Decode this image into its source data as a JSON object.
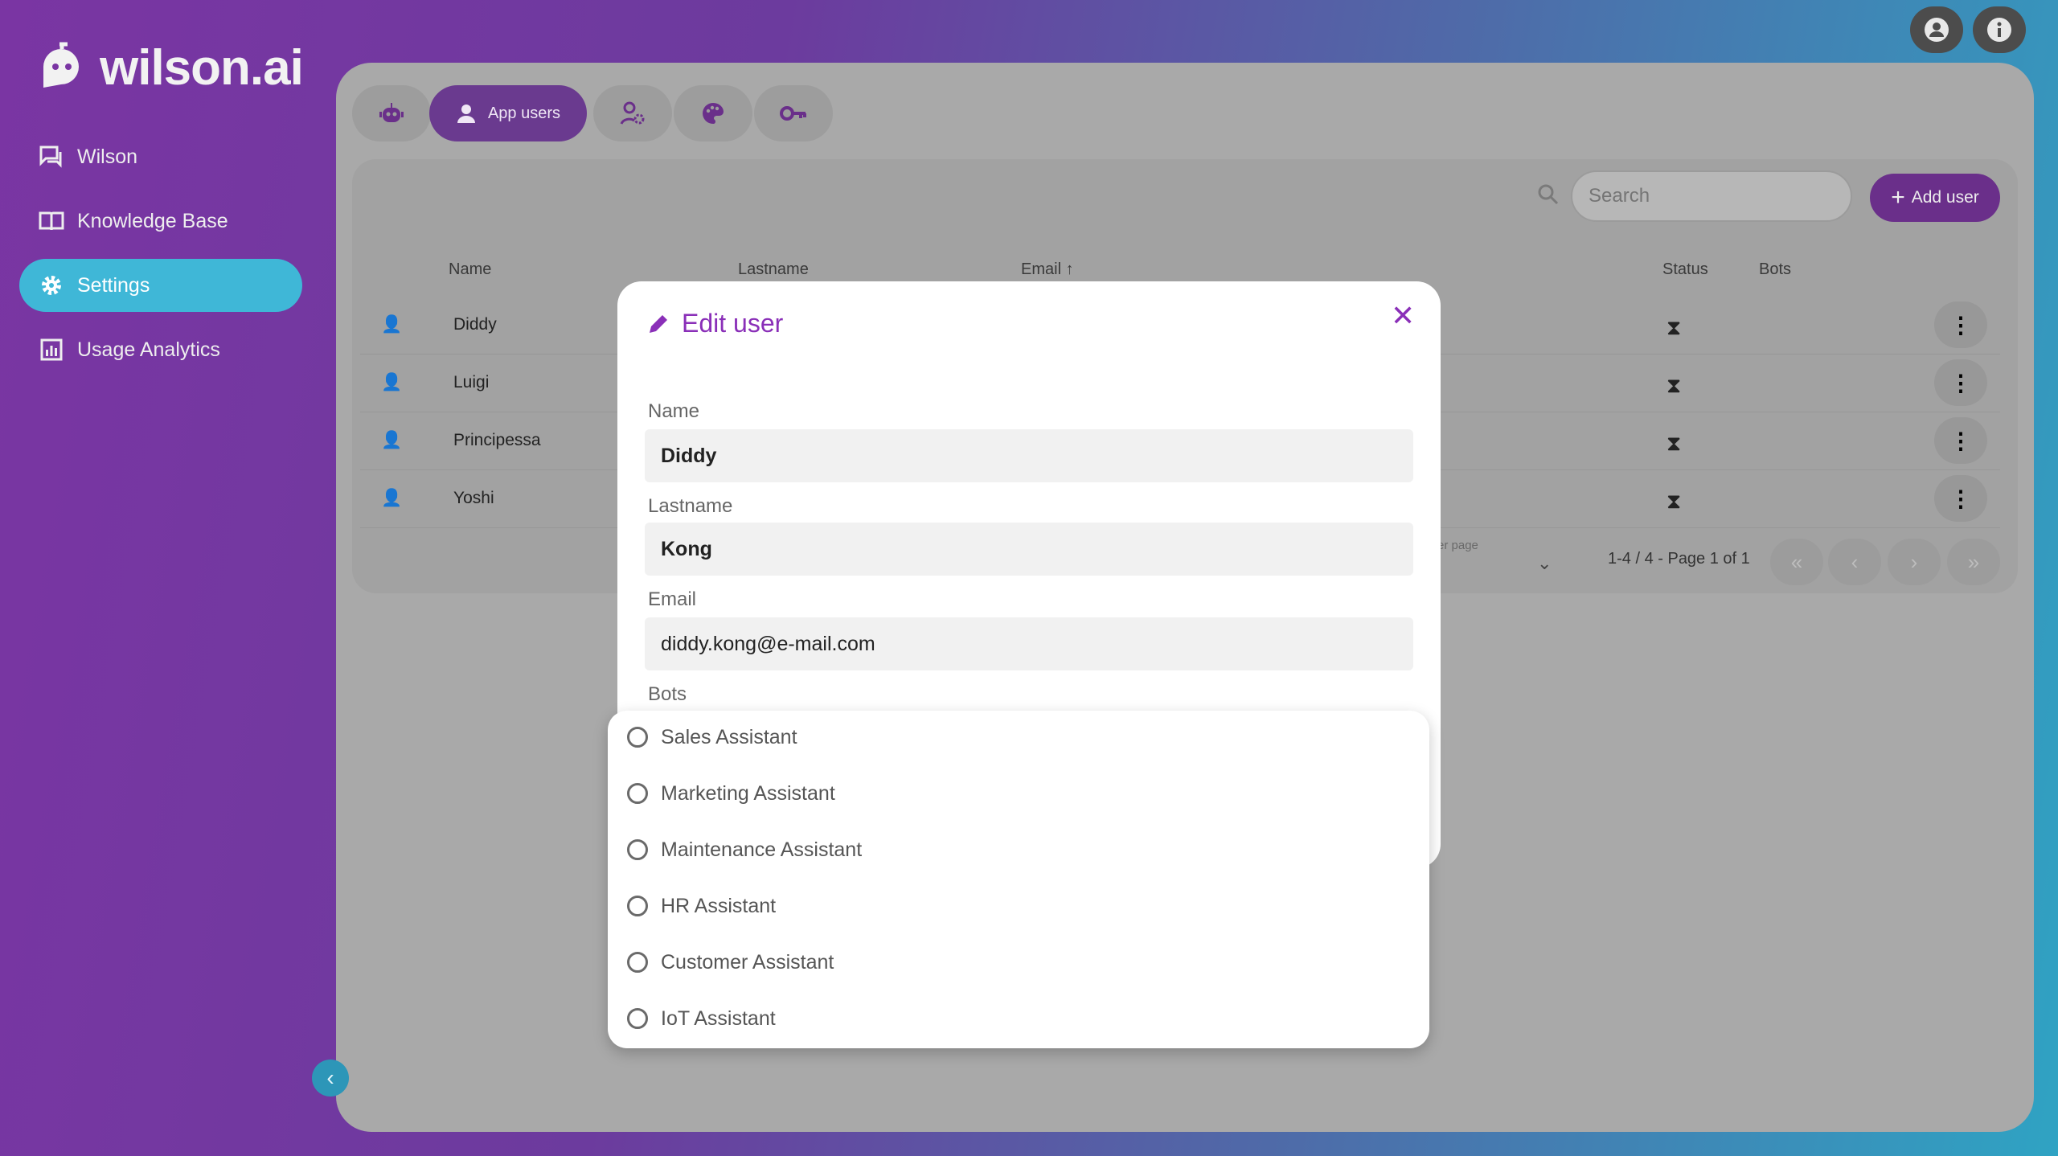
{
  "app": {
    "brand": "wilson.ai"
  },
  "sidebar": {
    "items": [
      {
        "label": "Wilson",
        "icon": "chat-icon"
      },
      {
        "label": "Knowledge Base",
        "icon": "book-icon"
      },
      {
        "label": "Settings",
        "icon": "gear-icon",
        "active": true
      },
      {
        "label": "Usage Analytics",
        "icon": "analytics-icon"
      }
    ]
  },
  "tabs": [
    {
      "icon": "robot-icon"
    },
    {
      "label": "App users",
      "icon": "user-icon",
      "active": true
    },
    {
      "icon": "user-settings-icon"
    },
    {
      "icon": "palette-icon"
    },
    {
      "icon": "key-icon"
    }
  ],
  "toolbar": {
    "search_placeholder": "Search",
    "add_label": "Add user"
  },
  "table": {
    "headers": {
      "name": "Name",
      "lastname": "Lastname",
      "email": "Email",
      "status": "Status",
      "bots": "Bots"
    },
    "rows": [
      {
        "name": "Diddy"
      },
      {
        "name": "Luigi"
      },
      {
        "name": "Principessa"
      },
      {
        "name": "Yoshi"
      }
    ],
    "per_page_label": "er page",
    "page_info": "1-4 / 4 - Page 1 of 1"
  },
  "modal": {
    "title": "Edit user",
    "fields": {
      "name_label": "Name",
      "name_value": "Diddy",
      "lastname_label": "Lastname",
      "lastname_value": "Kong",
      "email_label": "Email",
      "email_value": "diddy.kong@e-mail.com",
      "bots_label": "Bots"
    }
  },
  "bot_options": [
    "Sales Assistant",
    "Marketing Assistant",
    "Maintenance Assistant",
    "HR Assistant",
    "Customer Assistant",
    "IoT Assistant"
  ],
  "colors": {
    "accent": "#8a2fb8",
    "active_nav": "#3fb7d7",
    "tab_active": "#6a3a8f"
  }
}
